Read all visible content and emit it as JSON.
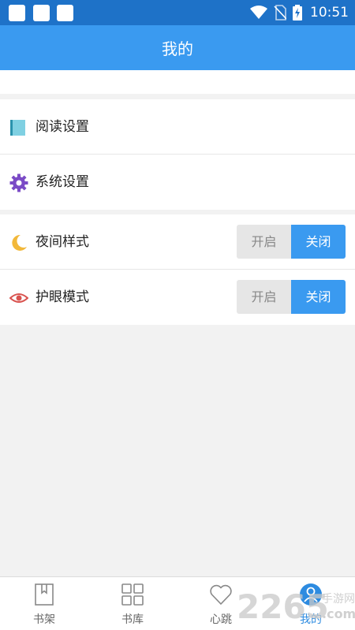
{
  "status_bar": {
    "time": "10:51",
    "icons": [
      "wifi-icon",
      "no-sim-icon",
      "battery-charging-icon"
    ]
  },
  "header": {
    "title": "我的"
  },
  "settings": {
    "reading": {
      "label": "阅读设置",
      "icon": "book-icon"
    },
    "system": {
      "label": "系统设置",
      "icon": "gear-icon"
    }
  },
  "toggles": {
    "night_mode": {
      "label": "夜间样式",
      "icon": "moon-icon",
      "on_label": "开启",
      "off_label": "关闭",
      "selected": "关闭"
    },
    "eye_care": {
      "label": "护眼模式",
      "icon": "eye-icon",
      "on_label": "开启",
      "off_label": "关闭",
      "selected": "关闭"
    }
  },
  "tabs": [
    {
      "label": "书架",
      "icon": "bookmark-book-icon"
    },
    {
      "label": "书库",
      "icon": "grid-icon"
    },
    {
      "label": "心跳",
      "icon": "heart-icon"
    },
    {
      "label": "我的",
      "icon": "user-icon",
      "active": true
    }
  ],
  "watermark": {
    "brand": "2265",
    "domain": ".com",
    "tagline": "手游网"
  },
  "colors": {
    "status_bar": "#1e72c8",
    "header": "#3a9af0",
    "accent": "#3a9af0",
    "background": "#f2f2f2"
  }
}
